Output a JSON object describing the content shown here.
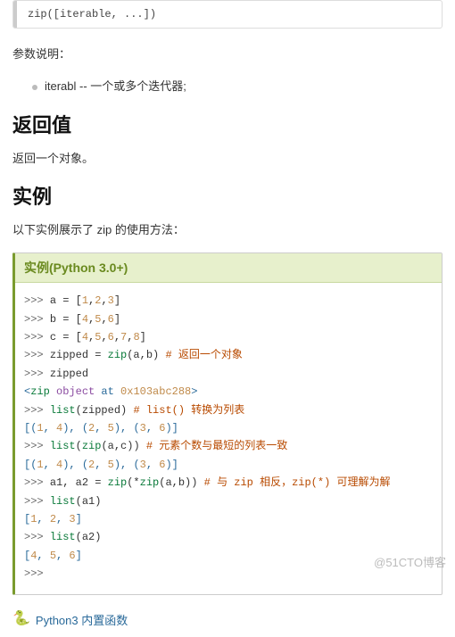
{
  "syntax": "zip([iterable, ...])",
  "params_intro": "参数说明：",
  "params": [
    "iterabl -- 一个或多个迭代器;"
  ],
  "h_return": "返回值",
  "p_return": "返回一个对象。",
  "h_example": "实例",
  "p_example_intro": "以下实例展示了 zip 的使用方法：",
  "example_title": "实例(Python 3.0+)",
  "code_lines": [
    [
      {
        "c": "tok-prompt",
        "t": ">>> "
      },
      {
        "c": "",
        "t": "a = ["
      },
      {
        "c": "tok-num",
        "t": "1"
      },
      {
        "c": "",
        "t": ","
      },
      {
        "c": "tok-num",
        "t": "2"
      },
      {
        "c": "",
        "t": ","
      },
      {
        "c": "tok-num",
        "t": "3"
      },
      {
        "c": "",
        "t": "]"
      }
    ],
    [
      {
        "c": "tok-prompt",
        "t": ">>> "
      },
      {
        "c": "",
        "t": "b = ["
      },
      {
        "c": "tok-num",
        "t": "4"
      },
      {
        "c": "",
        "t": ","
      },
      {
        "c": "tok-num",
        "t": "5"
      },
      {
        "c": "",
        "t": ","
      },
      {
        "c": "tok-num",
        "t": "6"
      },
      {
        "c": "",
        "t": "]"
      }
    ],
    [
      {
        "c": "tok-prompt",
        "t": ">>> "
      },
      {
        "c": "",
        "t": "c = ["
      },
      {
        "c": "tok-num",
        "t": "4"
      },
      {
        "c": "",
        "t": ","
      },
      {
        "c": "tok-num",
        "t": "5"
      },
      {
        "c": "",
        "t": ","
      },
      {
        "c": "tok-num",
        "t": "6"
      },
      {
        "c": "",
        "t": ","
      },
      {
        "c": "tok-num",
        "t": "7"
      },
      {
        "c": "",
        "t": ","
      },
      {
        "c": "tok-num",
        "t": "8"
      },
      {
        "c": "",
        "t": "]"
      }
    ],
    [
      {
        "c": "tok-prompt",
        "t": ">>> "
      },
      {
        "c": "",
        "t": "zipped = "
      },
      {
        "c": "tok-call",
        "t": "zip"
      },
      {
        "c": "",
        "t": "(a,b)     "
      },
      {
        "c": "tok-comment",
        "t": "# 返回一个对象"
      }
    ],
    [
      {
        "c": "tok-prompt",
        "t": ">>> "
      },
      {
        "c": "",
        "t": "zipped"
      }
    ],
    [
      {
        "c": "tok-out",
        "t": "<"
      },
      {
        "c": "tok-call",
        "t": "zip"
      },
      {
        "c": "tok-out",
        "t": " "
      },
      {
        "c": "tok-outvar",
        "t": "object"
      },
      {
        "c": "tok-out",
        "t": " at "
      },
      {
        "c": "tok-num",
        "t": "0x103abc288"
      },
      {
        "c": "tok-out",
        "t": ">"
      }
    ],
    [
      {
        "c": "tok-prompt",
        "t": ">>> "
      },
      {
        "c": "tok-call",
        "t": "list"
      },
      {
        "c": "",
        "t": "(zipped)  "
      },
      {
        "c": "tok-comment",
        "t": "# list() 转换为列表"
      }
    ],
    [
      {
        "c": "tok-out",
        "t": "[("
      },
      {
        "c": "tok-num",
        "t": "1"
      },
      {
        "c": "tok-out",
        "t": ", "
      },
      {
        "c": "tok-num",
        "t": "4"
      },
      {
        "c": "tok-out",
        "t": "), ("
      },
      {
        "c": "tok-num",
        "t": "2"
      },
      {
        "c": "tok-out",
        "t": ", "
      },
      {
        "c": "tok-num",
        "t": "5"
      },
      {
        "c": "tok-out",
        "t": "), ("
      },
      {
        "c": "tok-num",
        "t": "3"
      },
      {
        "c": "tok-out",
        "t": ", "
      },
      {
        "c": "tok-num",
        "t": "6"
      },
      {
        "c": "tok-out",
        "t": ")]"
      }
    ],
    [
      {
        "c": "tok-prompt",
        "t": ">>> "
      },
      {
        "c": "tok-call",
        "t": "list"
      },
      {
        "c": "",
        "t": "("
      },
      {
        "c": "tok-call",
        "t": "zip"
      },
      {
        "c": "",
        "t": "(a,c))              "
      },
      {
        "c": "tok-comment",
        "t": "# 元素个数与最短的列表一致"
      }
    ],
    [
      {
        "c": "tok-out",
        "t": "[("
      },
      {
        "c": "tok-num",
        "t": "1"
      },
      {
        "c": "tok-out",
        "t": ", "
      },
      {
        "c": "tok-num",
        "t": "4"
      },
      {
        "c": "tok-out",
        "t": "), ("
      },
      {
        "c": "tok-num",
        "t": "2"
      },
      {
        "c": "tok-out",
        "t": ", "
      },
      {
        "c": "tok-num",
        "t": "5"
      },
      {
        "c": "tok-out",
        "t": "), ("
      },
      {
        "c": "tok-num",
        "t": "3"
      },
      {
        "c": "tok-out",
        "t": ", "
      },
      {
        "c": "tok-num",
        "t": "6"
      },
      {
        "c": "tok-out",
        "t": ")]"
      }
    ],
    [
      {
        "c": "",
        "t": " "
      }
    ],
    [
      {
        "c": "tok-prompt",
        "t": ">>> "
      },
      {
        "c": "",
        "t": "a1, a2 = "
      },
      {
        "c": "tok-call",
        "t": "zip"
      },
      {
        "c": "",
        "t": "(*"
      },
      {
        "c": "tok-call",
        "t": "zip"
      },
      {
        "c": "",
        "t": "(a,b))          "
      },
      {
        "c": "tok-comment",
        "t": "# 与 zip 相反，zip(*) 可理解为解"
      }
    ],
    [
      {
        "c": "tok-prompt",
        "t": ">>> "
      },
      {
        "c": "tok-call",
        "t": "list"
      },
      {
        "c": "",
        "t": "(a1)"
      }
    ],
    [
      {
        "c": "tok-out",
        "t": "["
      },
      {
        "c": "tok-num",
        "t": "1"
      },
      {
        "c": "tok-out",
        "t": ", "
      },
      {
        "c": "tok-num",
        "t": "2"
      },
      {
        "c": "tok-out",
        "t": ", "
      },
      {
        "c": "tok-num",
        "t": "3"
      },
      {
        "c": "tok-out",
        "t": "]"
      }
    ],
    [
      {
        "c": "tok-prompt",
        "t": ">>> "
      },
      {
        "c": "tok-call",
        "t": "list"
      },
      {
        "c": "",
        "t": "(a2)"
      }
    ],
    [
      {
        "c": "tok-out",
        "t": "["
      },
      {
        "c": "tok-num",
        "t": "4"
      },
      {
        "c": "tok-out",
        "t": ", "
      },
      {
        "c": "tok-num",
        "t": "5"
      },
      {
        "c": "tok-out",
        "t": ", "
      },
      {
        "c": "tok-num",
        "t": "6"
      },
      {
        "c": "tok-out",
        "t": "]"
      }
    ],
    [
      {
        "c": "tok-prompt",
        "t": ">>>"
      }
    ]
  ],
  "footer_link": "Python3 内置函数",
  "watermark": "@51CTO博客"
}
